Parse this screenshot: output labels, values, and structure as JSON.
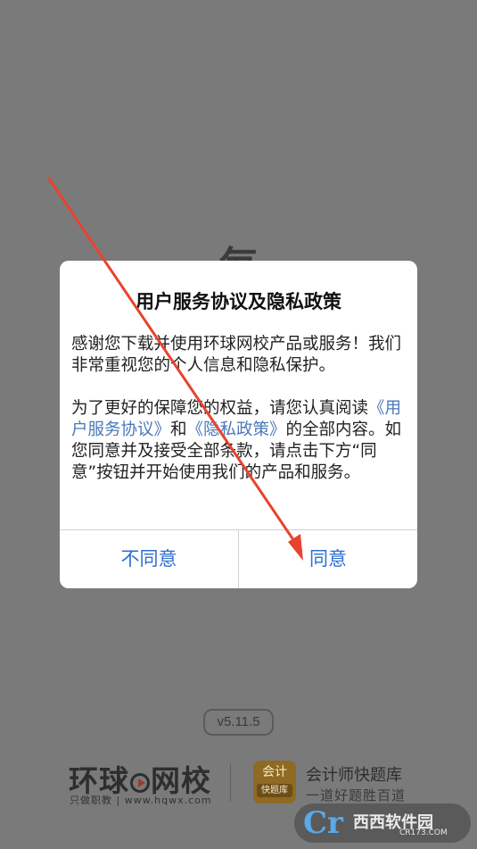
{
  "splash": {
    "slogan_partial": "每",
    "version": "v5.11.5"
  },
  "footer": {
    "brand_name_left": "环球",
    "brand_name_right": "网校",
    "brand_sub": "只做职教 | www.hqwx.com",
    "app_icon_top": "会计",
    "app_icon_bottom": "快题库",
    "app_name": "会计师快题库",
    "app_tagline": "一道好题胜百道"
  },
  "watermark": {
    "text": "西西软件园",
    "sub": "CR173.COM"
  },
  "dialog": {
    "title": "用户服务协议及隐私政策",
    "para1": "感谢您下载并使用环球网校产品或服务！我们非常重视您的个人信息和隐私保护。",
    "para2_before": "为了更好的保障您的权益，请您认真阅读",
    "link_user_agreement": "《用户服务协议》",
    "para2_and": "和",
    "link_privacy_policy": "《隐私政策》",
    "para2_after": "的全部内容。如您同意并及接受全部条款，请点击下方“同意”按钮并开始使用我们的产品和服务。",
    "disagree_label": "不同意",
    "agree_label": "同意"
  },
  "colors": {
    "link": "#4a78b8",
    "button_text": "#2c6ed0",
    "annotation_arrow": "#e8432f"
  }
}
